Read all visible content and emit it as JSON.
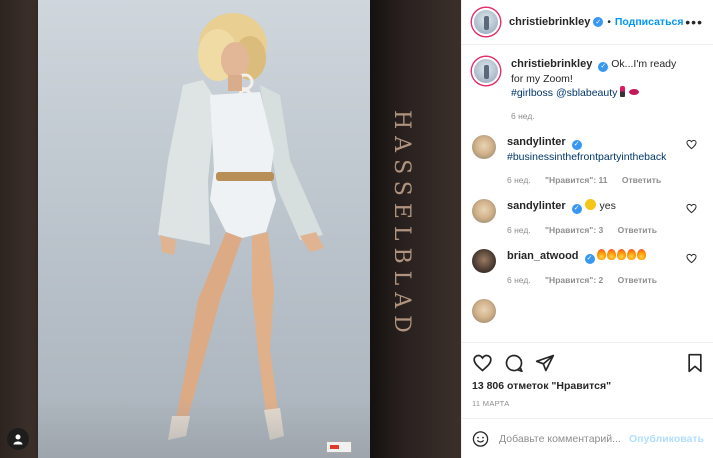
{
  "post": {
    "author": "christiebrinkley",
    "follow_label": "Подписаться",
    "dot": "•",
    "photo_brand_text": "HASSELBLAD"
  },
  "caption": {
    "username": "christiebrinkley",
    "text": "Ok...I'm ready for my Zoom!",
    "hashtag": "#girlboss",
    "mention": "@sblabeauty",
    "time": "6 нед."
  },
  "comments": [
    {
      "username": "sandylinter",
      "text": "",
      "hashtag": "#businessinthefrontpartyintheback",
      "time": "6 нед.",
      "likes": "\"Нравится\": 11",
      "reply": "Ответить"
    },
    {
      "username": "sandylinter",
      "text": "yes",
      "time": "6 нед.",
      "likes": "\"Нравится\": 3",
      "reply": "Ответить"
    },
    {
      "username": "brian_atwood",
      "text": "",
      "time": "6 нед.",
      "likes": "\"Нравится\": 2",
      "reply": "Ответить"
    }
  ],
  "stats": {
    "likes_text": "13 806 отметок \"Нравится\"",
    "date": "11 МАРТА"
  },
  "comment_box": {
    "placeholder": "Добавьте комментарий...",
    "publish_label": "Опубликовать"
  },
  "colors": {
    "accent": "#0095f6",
    "verified": "#3897f0",
    "muted": "#8e8e8e"
  }
}
